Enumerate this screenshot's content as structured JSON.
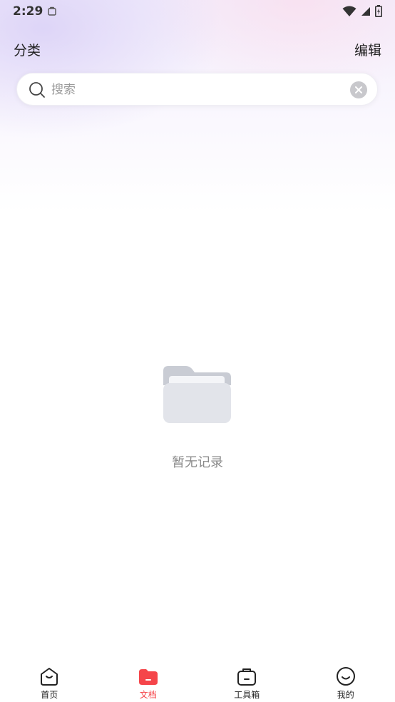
{
  "status_bar": {
    "time": "2:29",
    "notification_icon": "clipboard-icon",
    "wifi_icon": "wifi-icon",
    "signal_icon": "signal-icon",
    "battery_icon": "battery-icon"
  },
  "header": {
    "title": "分类",
    "edit_label": "编辑"
  },
  "search": {
    "placeholder": "搜索",
    "value": "",
    "search_icon": "search-icon",
    "clear_icon": "clear-icon"
  },
  "empty_state": {
    "icon": "folder-icon",
    "text": "暂无记录"
  },
  "bottom_nav": {
    "items": [
      {
        "label": "首页",
        "icon": "home-icon",
        "active": false
      },
      {
        "label": "文档",
        "icon": "documents-icon",
        "active": true
      },
      {
        "label": "工具箱",
        "icon": "toolbox-icon",
        "active": false
      },
      {
        "label": "我的",
        "icon": "profile-icon",
        "active": false
      }
    ]
  },
  "colors": {
    "accent": "#f5454a",
    "text_primary": "#222222",
    "text_secondary": "#8a8a8a",
    "folder_light": "#e2e4ea",
    "folder_dark": "#c9ccd4"
  }
}
